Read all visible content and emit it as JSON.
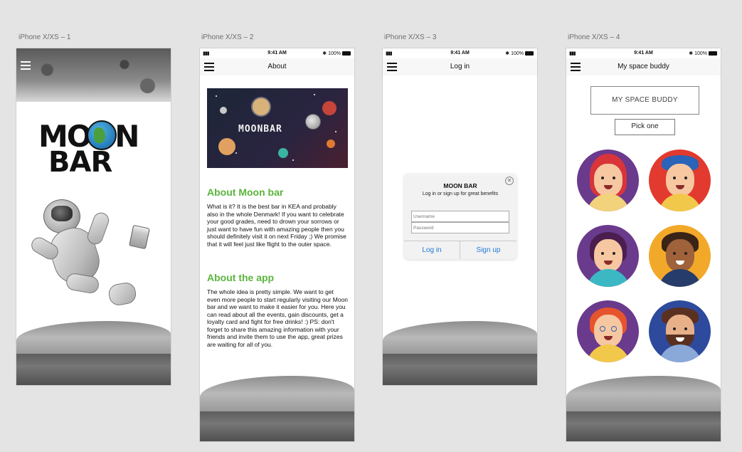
{
  "artboards": [
    {
      "label": "iPhone X/XS – 1"
    },
    {
      "label": "iPhone X/XS – 2"
    },
    {
      "label": "iPhone X/XS – 3"
    },
    {
      "label": "iPhone X/XS – 4"
    }
  ],
  "status_bar": {
    "signal": "▮▮▮ ",
    "time": "9:41 AM",
    "battery": "✱ 100%"
  },
  "phone1": {
    "logo_line1": "MOON",
    "logo_line2": "BAR"
  },
  "phone2": {
    "nav_title": "About",
    "banner_title": "MOONBAR",
    "about_heading": "About Moon bar",
    "about_body": "What is it? It is the best bar in KEA and probably also in the whole Denmark! If you want to celebrate your good grades, need to drown your sorrows or just want to have fun with amazing people then you should definitely visit it on next Friday ;) We promise that it will feel just like flight to the outer space.",
    "app_heading": "About the app",
    "app_body": "The whole idea is pretty simple. We want to get even more people to start regularly visiting our Moon bar and we want to make it easier for you. Here you can read about all the events, gain discounts, get a loyalty card and fight for free drinks! :) PS: don't forget to share this amazing information with your friends and invite them to use the app, great prizes are waiting for all of you."
  },
  "phone3": {
    "nav_title": "Log in",
    "dialog": {
      "title": "MOON BAR",
      "subtitle": "Log in or sign up for great benefits",
      "username_placeholder": "Username",
      "password_placeholder": "Password",
      "login_label": "Log in",
      "signup_label": "Sign up",
      "close_glyph": "✕"
    }
  },
  "phone4": {
    "nav_title": "My space buddy",
    "buddy_box": "MY SPACE BUDDY",
    "pick_label": "Pick one",
    "avatars": [
      {
        "name": "avatar-red-hair-girl",
        "bg": "#6a3a8c"
      },
      {
        "name": "avatar-cap-boy",
        "bg": "#e23a2e"
      },
      {
        "name": "avatar-ponytail-girl",
        "bg": "#6a3a8c"
      },
      {
        "name": "avatar-curly-boy",
        "bg": "#f2a92a"
      },
      {
        "name": "avatar-glasses-girl",
        "bg": "#6a3a8c"
      },
      {
        "name": "avatar-bearded-man",
        "bg": "#2e4a9c"
      }
    ]
  },
  "colors": {
    "heading_green": "#5ab53c",
    "link_blue": "#1e79d8",
    "canvas_bg": "#e4e4e4"
  }
}
